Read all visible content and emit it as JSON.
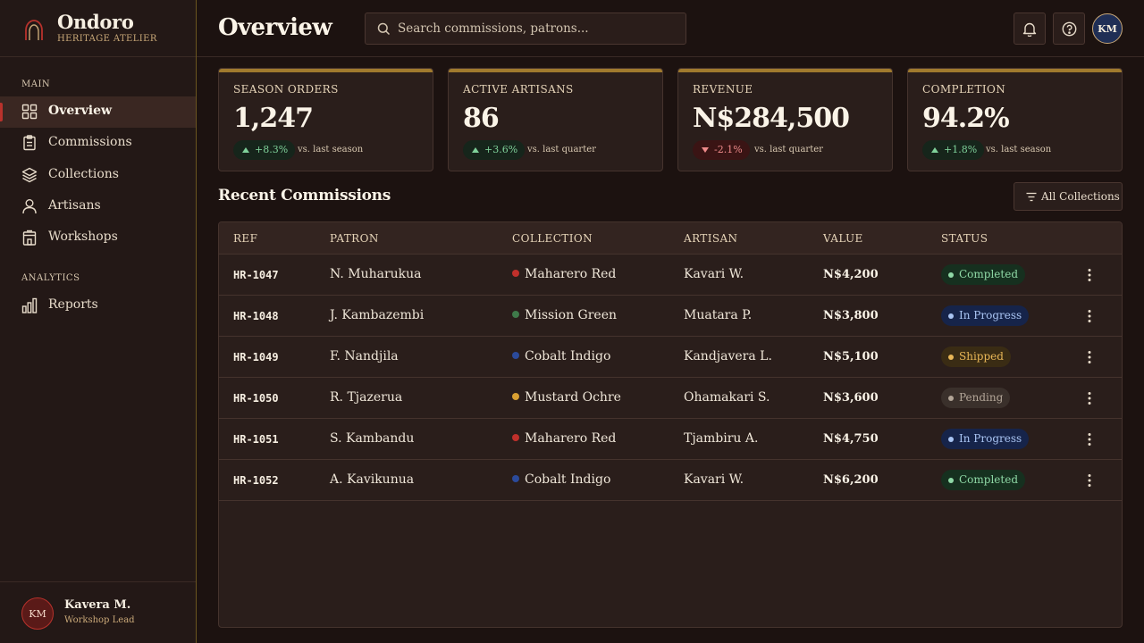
{
  "brand": {
    "name": "Ondoro",
    "subtitle": "HERITAGE ATELIER"
  },
  "sidebar": {
    "sections": [
      "MAIN",
      "ANALYTICS"
    ],
    "items": [
      {
        "label": "Overview",
        "icon": "grid-icon",
        "active": true
      },
      {
        "label": "Commissions",
        "icon": "clipboard-icon"
      },
      {
        "label": "Collections",
        "icon": "layers-icon"
      },
      {
        "label": "Artisans",
        "icon": "user-icon"
      },
      {
        "label": "Workshops",
        "icon": "building-icon"
      },
      {
        "label": "Reports",
        "icon": "bar-chart-icon"
      }
    ],
    "user": {
      "initials": "KM",
      "name": "Kavera M.",
      "role": "Workshop Lead"
    }
  },
  "header": {
    "title": "Overview",
    "search_placeholder": "Search commissions, patrons...",
    "avatar_initials": "KM"
  },
  "kpis": [
    {
      "label": "SEASON ORDERS",
      "value": "1,247",
      "change": "+8.3%",
      "direction": "up",
      "compare": "vs. last season"
    },
    {
      "label": "ACTIVE ARTISANS",
      "value": "86",
      "change": "+3.6%",
      "direction": "up",
      "compare": "vs. last quarter"
    },
    {
      "label": "REVENUE",
      "value": "N$284,500",
      "change": "-2.1%",
      "direction": "down",
      "compare": "vs. last quarter"
    },
    {
      "label": "COMPLETION",
      "value": "94.2%",
      "change": "+1.8%",
      "direction": "up",
      "compare": "vs. last season"
    }
  ],
  "commissions": {
    "title": "Recent Commissions",
    "filter_label": "All Collections",
    "columns": [
      "REF",
      "PATRON",
      "COLLECTION",
      "ARTISAN",
      "VALUE",
      "STATUS"
    ],
    "rows": [
      {
        "ref": "HR-1047",
        "patron": "N. Muharukua",
        "collection": "Maharero Red",
        "collection_color": "#c0302b",
        "artisan": "Kavari W.",
        "value": "N$4,200",
        "status": "Completed",
        "status_type": "completed"
      },
      {
        "ref": "HR-1048",
        "patron": "J. Kambazembi",
        "collection": "Mission Green",
        "collection_color": "#3f7a4a",
        "artisan": "Muatara P.",
        "value": "N$3,800",
        "status": "In Progress",
        "status_type": "progress"
      },
      {
        "ref": "HR-1049",
        "patron": "F. Nandjila",
        "collection": "Cobalt Indigo",
        "collection_color": "#2b4a9a",
        "artisan": "Kandjavera L.",
        "value": "N$5,100",
        "status": "Shipped",
        "status_type": "shipped"
      },
      {
        "ref": "HR-1050",
        "patron": "R. Tjazerua",
        "collection": "Mustard Ochre",
        "collection_color": "#d9a032",
        "artisan": "Ohamakari S.",
        "value": "N$3,600",
        "status": "Pending",
        "status_type": "pending"
      },
      {
        "ref": "HR-1051",
        "patron": "S. Kambandu",
        "collection": "Maharero Red",
        "collection_color": "#c0302b",
        "artisan": "Tjambiru A.",
        "value": "N$4,750",
        "status": "In Progress",
        "status_type": "progress"
      },
      {
        "ref": "HR-1052",
        "patron": "A. Kavikunua",
        "collection": "Cobalt Indigo",
        "collection_color": "#2b4a9a",
        "artisan": "Kavari W.",
        "value": "N$6,200",
        "status": "Completed",
        "status_type": "completed"
      }
    ]
  }
}
